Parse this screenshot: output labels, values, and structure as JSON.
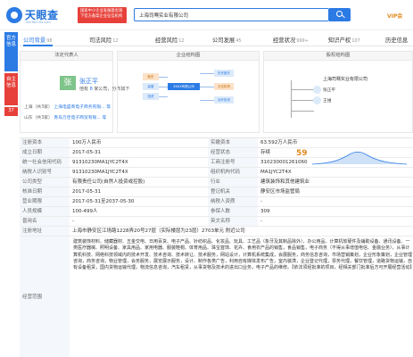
{
  "header": {
    "logo_text": "天眼查",
    "logo_sub": "TianYanCha.com",
    "promo_text": "国家中小企业发展基金旗下官方备案企业征信机构",
    "search_value": "上海司骞实业有限公司",
    "vip_label": "VIP会"
  },
  "left_tabs": [
    "官方信息",
    "自主信息",
    "37"
  ],
  "tabs": [
    {
      "label": "公司背景",
      "count": "98",
      "active": true
    },
    {
      "label": "司法风险",
      "count": "12"
    },
    {
      "label": "经营风险",
      "count": "12"
    },
    {
      "label": "公司发展",
      "count": "45"
    },
    {
      "label": "经营状况",
      "count": "999+"
    },
    {
      "label": "知识产权",
      "count": "107"
    },
    {
      "label": "历史信息",
      "count": ""
    }
  ],
  "legal_rep": {
    "title": "法定代表人",
    "avatar_char": "张",
    "name": "张正平",
    "meta_prefix": "他有",
    "meta_count": "8",
    "meta_suffix": "家公司，分布如下",
    "rows": [
      {
        "region": "上海（共3家）",
        "companies": "上海电盛商电子商务有限... 等"
      },
      {
        "region": "山东（共3家）",
        "companies": "青岛万佳电子商贸有限... 等"
      }
    ]
  },
  "structure": {
    "title": "企业结构图",
    "center": "XXXX有限公司",
    "left_nodes": [
      "股东",
      "高管",
      "投资"
    ],
    "right_nodes": [
      "历史股东",
      "分支机构",
      "对外投资"
    ]
  },
  "shareholders": {
    "title": "股权结构图",
    "company": "上海司骞实业有限公司",
    "holders": [
      "张正平",
      "王维"
    ]
  },
  "info": {
    "rows": [
      {
        "k1": "注册资本",
        "v1": "100万人民币",
        "k2": "实缴资本",
        "v2": "63.592万人民币"
      },
      {
        "k1": "成立日期",
        "v1": "2017-05-31",
        "k2": "经营状态",
        "v2": "存续"
      },
      {
        "k1": "统一社会信用代码",
        "v1": "91310230MA1JYC2T4X",
        "k2": "工商注册号",
        "v2": "310230001261060"
      },
      {
        "k1": "纳税人识别号",
        "v1": "91310230MA1JYC2T4X",
        "k2": "组织机构代码",
        "v2": "MA1JYC2T4X"
      },
      {
        "k1": "公司类型",
        "v1": "有限责任公司(自然人投资或控股)",
        "k2": "行业",
        "v2": "建筑装饰和其他建筑业"
      },
      {
        "k1": "核准日期",
        "v1": "2017-05-31",
        "k2": "登记机关",
        "v2": "静安区市场监管局"
      },
      {
        "k1": "营业期限",
        "v1": "2017-05-31至2037-05-30",
        "k2": "纳税人资质",
        "v2": "-"
      },
      {
        "k1": "人员规模",
        "v1": "100-499人",
        "k2": "参保人数",
        "v2": "309"
      },
      {
        "k1": "曾用名",
        "v1": "-",
        "k2": "英文名称",
        "v2": "-"
      }
    ],
    "score_label": "评分",
    "score_value": "59",
    "address_label": "注册地址",
    "address_value": "上海市静安区江场路1228弄20号27层（实际楼层为23层）2703单元 附近公司",
    "scope_label": "经营范围",
    "scope_text": "建筑装饰材料、储藏器材、五金交电、日用百货、电子产品、针纺织品、化妆品、玩具、工艺品（象牙及其制品除外）、办公用品、计算机软硬件及辅助设备、通讯设备、一类医疗器械、照明设备、家具用品、家用电器、服装鞋帽、体育用品、珠宝首饰、花卉、食用农产品的销售，食品销售，电子商务（不得从事增值电信、金融业务），从事计算机科技、网络科技领域内的技术开发、技术咨询、技术转让、技术服务，网站设计，计算机系统集成，会展服务，商务信息咨询，市场营销策划，企业形象策划，企业管理咨询，商务咨询，物业管理，会务服务，展览展示服务，设计、制作各类广告，利用自有媒体发布广告，室内装潢，企业登记代理，票务代理，餐饮管理，道路货物运输，自有设备租赁，国内货物运输代理，物流信息咨询，汽车租赁，从事货物及技术的进出口业务，电子产品的维修。【依法须经批准的项目，经相关部门批准后方可开展经营活动】"
  },
  "colors": {
    "accent": "#2c7be5",
    "red": "#e7403a",
    "orange": "#e08a1e"
  }
}
